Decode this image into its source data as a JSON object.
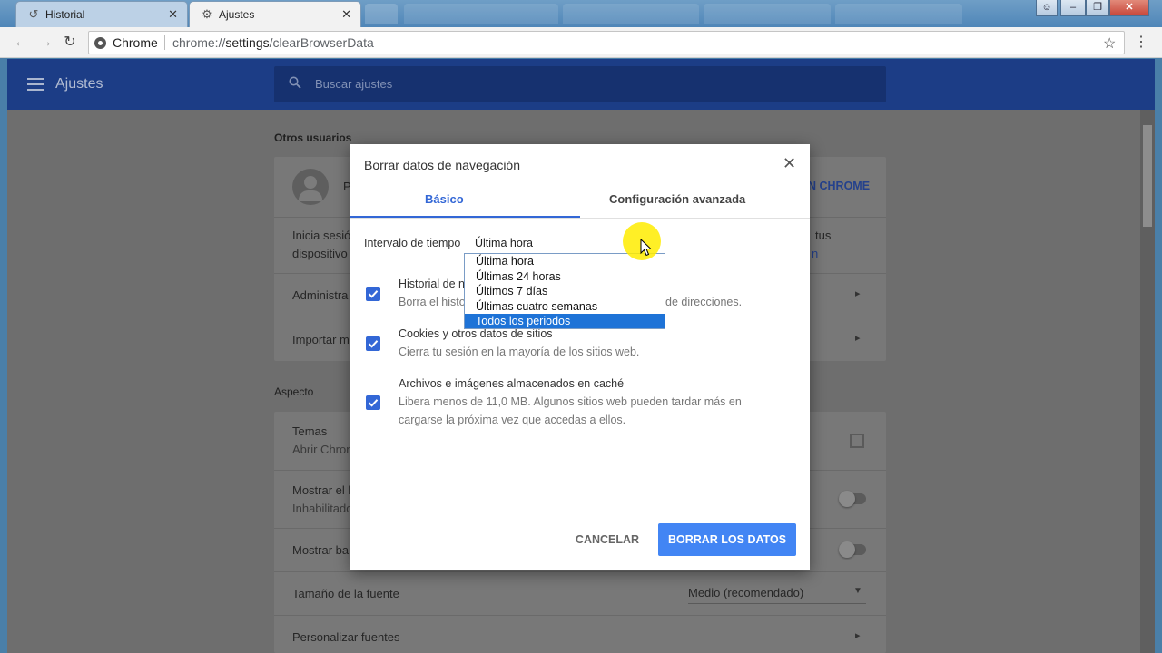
{
  "browser": {
    "tabs": [
      {
        "label": "Historial",
        "icon": "history-icon",
        "active": false
      },
      {
        "label": "Ajustes",
        "icon": "gear-icon",
        "active": true
      }
    ],
    "omnibox": {
      "chip": "Chrome",
      "url_scheme": "chrome://",
      "url_host": "settings",
      "url_path": "/clearBrowserData"
    }
  },
  "settings": {
    "header_title": "Ajustes",
    "search_placeholder": "Buscar ajustes",
    "section_people": "Otros usuarios",
    "section_appearance": "Aspecto",
    "people_rows": {
      "profile_initial": "P",
      "signin_link": "N CHROME",
      "signin_text_1": "Inicia sesió",
      "signin_text_2": "dispositivo",
      "signin_tail_1": "tus",
      "signin_tail_2": "n",
      "manage": "Administra",
      "import": "Importar m"
    },
    "appearance_rows": {
      "themes_title": "Temas",
      "themes_sub": "Abrir Chron",
      "home_title": "Mostrar el b",
      "home_sub": "Inhabilitado",
      "bookmarks": "Mostrar ba",
      "font_size_label": "Tamaño de la fuente",
      "font_size_value": "Medio (recomendado)",
      "custom_fonts": "Personalizar fuentes"
    }
  },
  "dialog": {
    "title": "Borrar datos de navegación",
    "tab_basic": "Básico",
    "tab_advanced": "Configuración avanzada",
    "range_label": "Intervalo de tiempo",
    "range_value": "Última hora",
    "range_options": [
      "Última hora",
      "Últimas 24 horas",
      "Últimos 7 días",
      "Últimas cuatro semanas",
      "Todos los periodos"
    ],
    "range_highlighted": "Todos los periodos",
    "items": [
      {
        "title": "Historial de n",
        "desc": "Borra el histo",
        "desc_tail": "de direcciones.",
        "checked": true
      },
      {
        "title": "Cookies y otros datos de sitios",
        "desc": "Cierra tu sesión en la mayoría de los sitios web.",
        "checked": true
      },
      {
        "title": "Archivos e imágenes almacenados en caché",
        "desc": "Libera menos de 11,0 MB. Algunos sitios web pueden tardar más en cargarse la próxima vez que accedas a ellos.",
        "checked": true
      }
    ],
    "cancel_label": "CANCELAR",
    "clear_label": "BORRAR LOS DATOS"
  },
  "colors": {
    "accent": "#3367d6",
    "primary_button": "#4285f4",
    "header": "#1c3d86",
    "dropdown_selected": "#1e73d7"
  }
}
